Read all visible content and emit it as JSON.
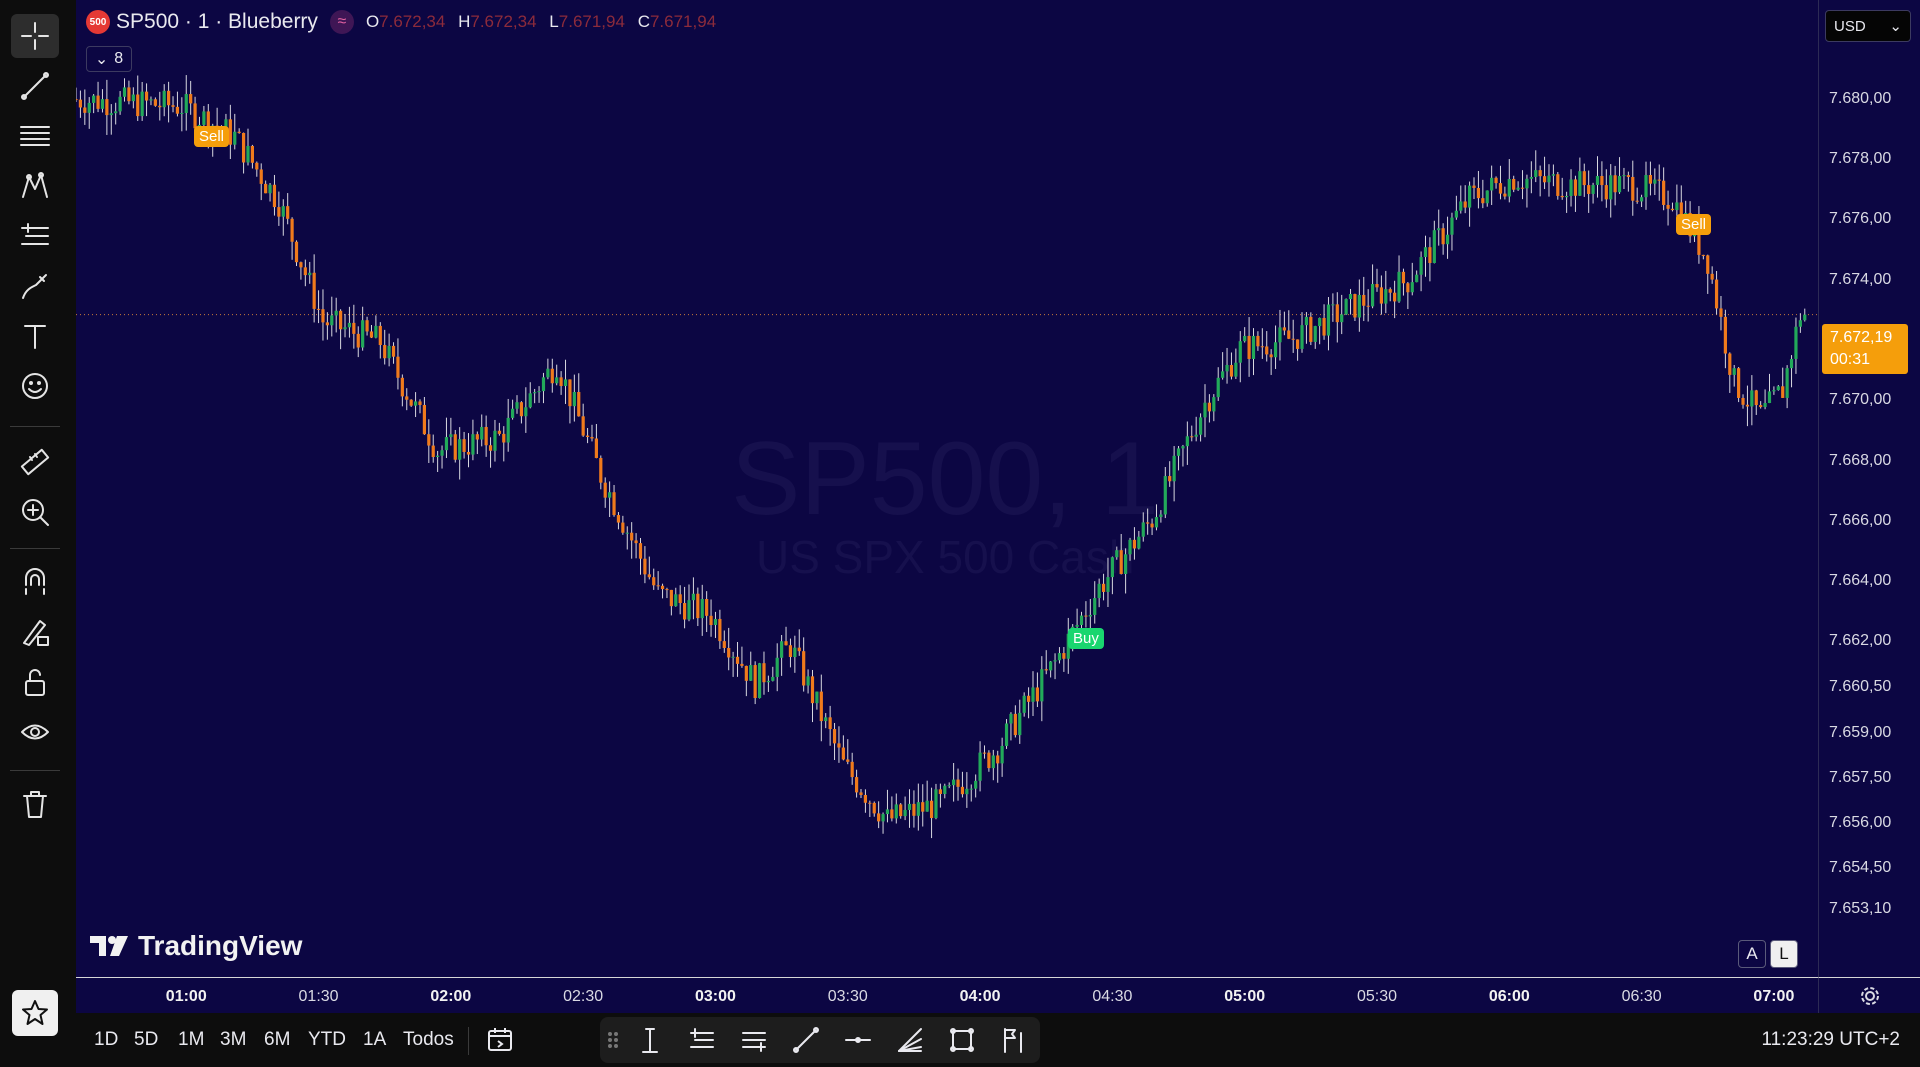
{
  "legend": {
    "symbol_badge": "500",
    "title": "SP500 · 1 · Blueberry",
    "indicator_icon": "wave-icon",
    "o_label": "O",
    "o_value": "7.672,34",
    "h_label": "H",
    "h_value": "7.672,34",
    "l_label": "L",
    "l_value": "7.671,94",
    "c_label": "C",
    "c_value": "7.671,94",
    "indicators_count": "8"
  },
  "watermark": {
    "symbol": "SP500, 1",
    "description": "US SPX 500 Cash"
  },
  "logo": "TradingView",
  "currency": "USD",
  "price_ticks": [
    "7.680,00",
    "7.678,00",
    "7.676,00",
    "7.674,00",
    "7.672,00",
    "7.670,00",
    "7.668,00",
    "7.666,00",
    "7.664,00",
    "7.662,00",
    "7.660,50",
    "7.659,00",
    "7.657,50",
    "7.656,00",
    "7.654,50",
    "7.653,10"
  ],
  "current_price": {
    "value": "7.672,19",
    "countdown": "00:31"
  },
  "time_ticks": [
    "01:00",
    "01:30",
    "02:00",
    "02:30",
    "03:00",
    "03:30",
    "04:00",
    "04:30",
    "05:00",
    "05:30",
    "06:00",
    "06:30",
    "07:00"
  ],
  "time_ticks_major": [
    true,
    false,
    true,
    false,
    true,
    false,
    true,
    false,
    true,
    false,
    true,
    false,
    true
  ],
  "scale_buttons": {
    "auto": "A",
    "log": "L"
  },
  "signals": [
    {
      "label": "Sell",
      "type": "sell"
    },
    {
      "label": "Sell",
      "type": "sell"
    },
    {
      "label": "Buy",
      "type": "buy"
    }
  ],
  "ranges": [
    "1D",
    "5D",
    "1M",
    "3M",
    "6M",
    "YTD",
    "1A",
    "Todos"
  ],
  "clock": "11:23:29 UTC+2",
  "colors": {
    "background": "#0c0643",
    "up": "#22a95a",
    "down": "#f07a1c",
    "sell": "#f59e0b",
    "buy": "#19d66f"
  },
  "chart_data": {
    "type": "candlestick",
    "x_unit": "time",
    "y_unit": "price",
    "ylim": [
      7652.8,
      7681.4
    ],
    "xlim": [
      "00:35",
      "07:10"
    ],
    "key_points": [
      {
        "x": "00:35",
        "y": 7678.5
      },
      {
        "x": "01:00",
        "y": 7678.3
      },
      {
        "x": "01:12",
        "y": 7677.4
      },
      {
        "x": "01:22",
        "y": 7675.5
      },
      {
        "x": "01:32",
        "y": 7672.0
      },
      {
        "x": "01:45",
        "y": 7671.4
      },
      {
        "x": "01:58",
        "y": 7668.2
      },
      {
        "x": "02:12",
        "y": 7668.6
      },
      {
        "x": "02:25",
        "y": 7670.8
      },
      {
        "x": "02:35",
        "y": 7667.5
      },
      {
        "x": "02:48",
        "y": 7664.0
      },
      {
        "x": "03:00",
        "y": 7663.4
      },
      {
        "x": "03:10",
        "y": 7661.4
      },
      {
        "x": "03:18",
        "y": 7662.5
      },
      {
        "x": "03:30",
        "y": 7659.0
      },
      {
        "x": "03:40",
        "y": 7657.4
      },
      {
        "x": "03:52",
        "y": 7657.9
      },
      {
        "x": "04:05",
        "y": 7659.5
      },
      {
        "x": "04:18",
        "y": 7662.0
      },
      {
        "x": "04:28",
        "y": 7664.2
      },
      {
        "x": "04:40",
        "y": 7666.2
      },
      {
        "x": "04:52",
        "y": 7669.6
      },
      {
        "x": "05:00",
        "y": 7671.2
      },
      {
        "x": "05:12",
        "y": 7671.5
      },
      {
        "x": "05:25",
        "y": 7672.4
      },
      {
        "x": "05:38",
        "y": 7673.2
      },
      {
        "x": "05:52",
        "y": 7675.6
      },
      {
        "x": "06:02",
        "y": 7676.2
      },
      {
        "x": "06:15",
        "y": 7676.0
      },
      {
        "x": "06:28",
        "y": 7676.0
      },
      {
        "x": "06:38",
        "y": 7675.6
      },
      {
        "x": "06:46",
        "y": 7673.8
      },
      {
        "x": "06:52",
        "y": 7670.2
      },
      {
        "x": "06:58",
        "y": 7669.2
      },
      {
        "x": "07:03",
        "y": 7670.0
      },
      {
        "x": "07:07",
        "y": 7672.2
      }
    ]
  }
}
